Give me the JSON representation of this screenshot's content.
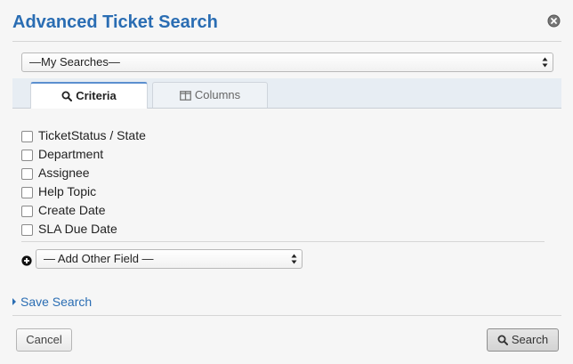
{
  "dialog": {
    "title": "Advanced Ticket Search",
    "close_icon": "close-circle-icon"
  },
  "saved_searches": {
    "selected": "—My Searches—"
  },
  "tabs": [
    {
      "label": "Criteria",
      "icon": "search-icon",
      "active": true
    },
    {
      "label": "Columns",
      "icon": "columns-icon",
      "active": false
    }
  ],
  "criteria": [
    {
      "label": "TicketStatus / State",
      "checked": false
    },
    {
      "label": "Department",
      "checked": false
    },
    {
      "label": "Assignee",
      "checked": false
    },
    {
      "label": "Help Topic",
      "checked": false
    },
    {
      "label": "Create Date",
      "checked": false
    },
    {
      "label": "SLA Due Date",
      "checked": false
    }
  ],
  "add_field": {
    "icon": "plus-circle-icon",
    "selected": "— Add Other Field —"
  },
  "save_search": {
    "label": "Save Search",
    "icon": "caret-right-icon"
  },
  "buttons": {
    "cancel": "Cancel",
    "search": "Search",
    "search_icon": "search-icon"
  },
  "colors": {
    "accent": "#2a6db3",
    "tab_active_border": "#5b8fcf"
  }
}
